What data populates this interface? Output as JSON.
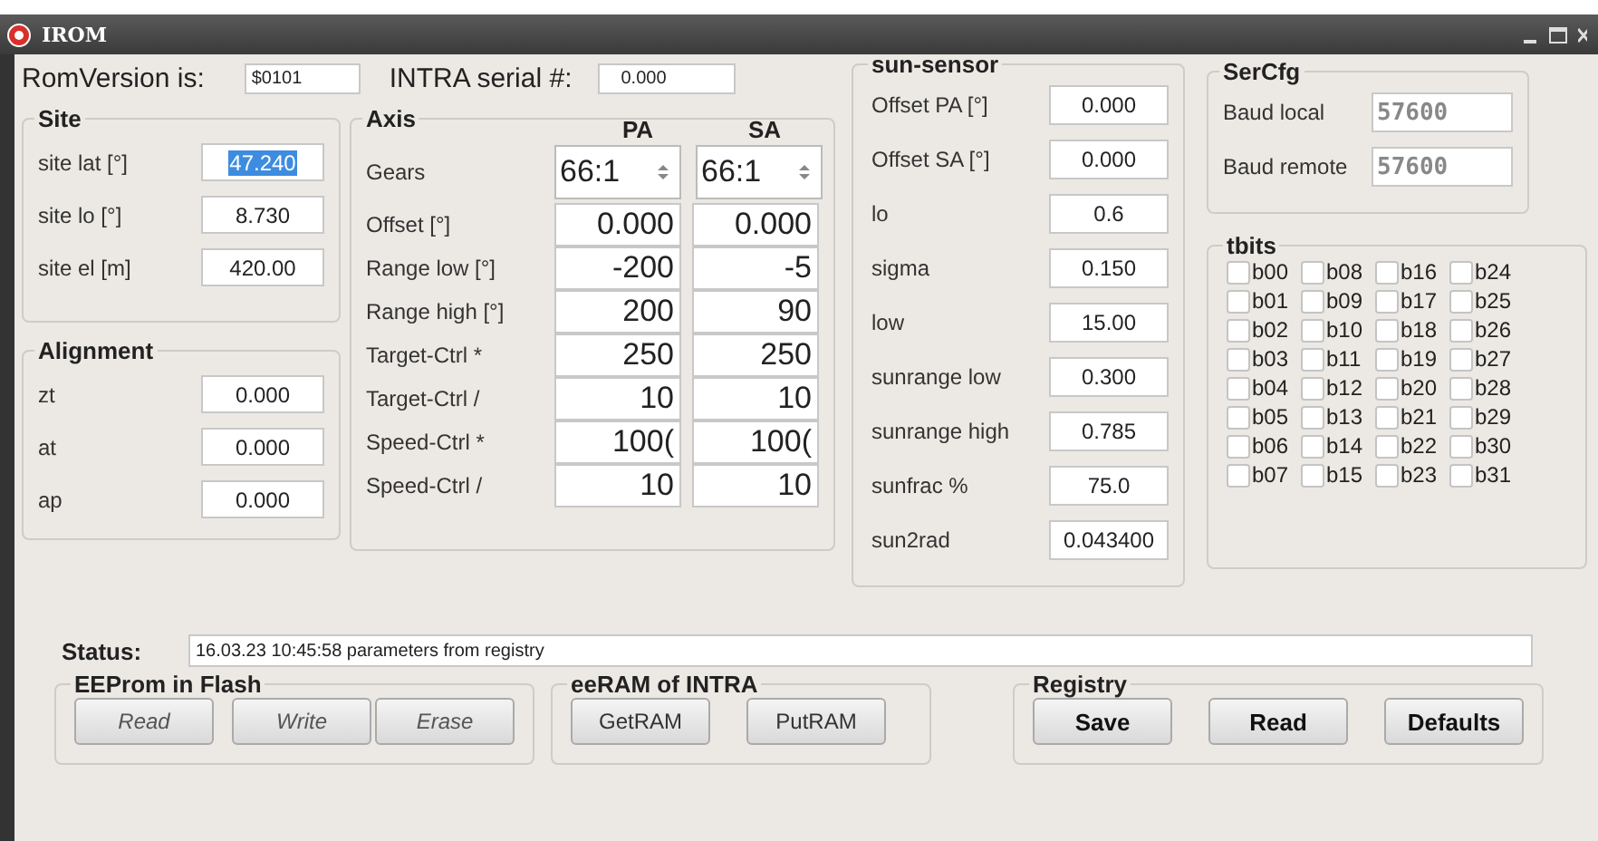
{
  "window": {
    "title": "IROM"
  },
  "header": {
    "rom_label": "RomVersion is:",
    "rom_value": "$0101",
    "serial_label": "INTRA serial #:",
    "serial_value": "0.000"
  },
  "site": {
    "title": "Site",
    "fields": [
      {
        "label": "site lat [°]",
        "value": "47.240",
        "selected": true
      },
      {
        "label": "site lo [°]",
        "value": "8.730",
        "selected": false
      },
      {
        "label": "site el [m]",
        "value": "420.00",
        "selected": false
      }
    ]
  },
  "alignment": {
    "title": "Alignment",
    "fields": [
      {
        "label": "zt",
        "value": "0.000"
      },
      {
        "label": "at",
        "value": "0.000"
      },
      {
        "label": "ap",
        "value": "0.000"
      }
    ]
  },
  "axis": {
    "title": "Axis",
    "columns": [
      "PA",
      "SA"
    ],
    "rows": [
      {
        "label": "Gears",
        "kind": "spinner",
        "values": [
          "66:1",
          "66:1"
        ]
      },
      {
        "label": "Offset [°]",
        "kind": "number",
        "values": [
          "0.000",
          "0.000"
        ]
      },
      {
        "label": "Range low [°]",
        "kind": "number",
        "values": [
          "-200",
          "-5"
        ]
      },
      {
        "label": "Range high [°]",
        "kind": "number",
        "values": [
          "200",
          "90"
        ]
      },
      {
        "label": "Target-Ctrl *",
        "kind": "number",
        "values": [
          "250",
          "250"
        ]
      },
      {
        "label": "Target-Ctrl /",
        "kind": "number",
        "values": [
          "10",
          "10"
        ]
      },
      {
        "label": "Speed-Ctrl *",
        "kind": "number",
        "values": [
          "100(",
          "100("
        ]
      },
      {
        "label": "Speed-Ctrl /",
        "kind": "number",
        "values": [
          "10",
          "10"
        ]
      }
    ]
  },
  "sun_sensor": {
    "title": "sun-sensor",
    "fields": [
      {
        "label": "Offset PA [°]",
        "value": "0.000"
      },
      {
        "label": "Offset SA [°]",
        "value": "0.000"
      },
      {
        "label": "lo",
        "value": "0.6"
      },
      {
        "label": "sigma",
        "value": "0.150"
      },
      {
        "label": "low",
        "value": "15.00"
      },
      {
        "label": "sunrange low",
        "value": "0.300"
      },
      {
        "label": "sunrange high",
        "value": "0.785"
      },
      {
        "label": "sunfrac %",
        "value": "75.0"
      },
      {
        "label": "sun2rad",
        "value": "0.043400"
      }
    ]
  },
  "ser_cfg": {
    "title": "SerCfg",
    "fields": [
      {
        "label": "Baud local",
        "value": "57600",
        "disabled": true
      },
      {
        "label": "Baud remote",
        "value": "57600",
        "disabled": true
      }
    ]
  },
  "tbits": {
    "title": "tbits",
    "bits": [
      {
        "label": "b00",
        "checked": false
      },
      {
        "label": "b08",
        "checked": false
      },
      {
        "label": "b16",
        "checked": false
      },
      {
        "label": "b24",
        "checked": false
      },
      {
        "label": "b01",
        "checked": false
      },
      {
        "label": "b09",
        "checked": false
      },
      {
        "label": "b17",
        "checked": false
      },
      {
        "label": "b25",
        "checked": false
      },
      {
        "label": "b02",
        "checked": false
      },
      {
        "label": "b10",
        "checked": false
      },
      {
        "label": "b18",
        "checked": false
      },
      {
        "label": "b26",
        "checked": false
      },
      {
        "label": "b03",
        "checked": false
      },
      {
        "label": "b11",
        "checked": false
      },
      {
        "label": "b19",
        "checked": false
      },
      {
        "label": "b27",
        "checked": false
      },
      {
        "label": "b04",
        "checked": false
      },
      {
        "label": "b12",
        "checked": false
      },
      {
        "label": "b20",
        "checked": false
      },
      {
        "label": "b28",
        "checked": false
      },
      {
        "label": "b05",
        "checked": false
      },
      {
        "label": "b13",
        "checked": false
      },
      {
        "label": "b21",
        "checked": false
      },
      {
        "label": "b29",
        "checked": false
      },
      {
        "label": "b06",
        "checked": false
      },
      {
        "label": "b14",
        "checked": false
      },
      {
        "label": "b22",
        "checked": false
      },
      {
        "label": "b30",
        "checked": false
      },
      {
        "label": "b07",
        "checked": false
      },
      {
        "label": "b15",
        "checked": false
      },
      {
        "label": "b23",
        "checked": false
      },
      {
        "label": "b31",
        "checked": false
      }
    ]
  },
  "status": {
    "label": "Status:",
    "value": "16.03.23 10:45:58 parameters from registry"
  },
  "groups": [
    {
      "title": "EEProm in Flash",
      "kind": "italic",
      "buttons": [
        "Read",
        "Write",
        "Erase"
      ]
    },
    {
      "title": "eeRAM of INTRA",
      "kind": "plain",
      "buttons": [
        "GetRAM",
        "PutRAM"
      ]
    },
    {
      "title": "Registry",
      "kind": "bold",
      "buttons": [
        "Save",
        "Read",
        "Defaults"
      ]
    }
  ]
}
